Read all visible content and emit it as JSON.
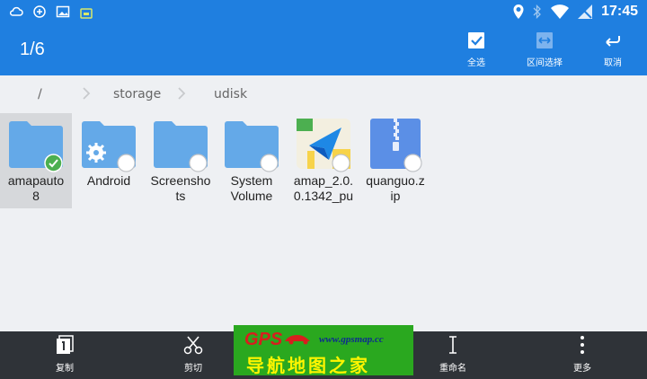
{
  "status_bar": {
    "time": "17:45",
    "left_icons": [
      "cloud-icon",
      "sync-icon",
      "image-icon",
      "android-icon"
    ],
    "right_icons": [
      "location-icon",
      "bluetooth-icon",
      "wifi-icon",
      "no-signal-icon"
    ]
  },
  "app_bar": {
    "selection_count": "1/6",
    "actions": [
      {
        "label": "全选",
        "icon": "select-all-icon"
      },
      {
        "label": "区间选择",
        "icon": "range-select-icon"
      },
      {
        "label": "取消",
        "icon": "cancel-icon"
      }
    ]
  },
  "breadcrumb": {
    "items": [
      "/",
      "storage",
      "udisk"
    ]
  },
  "files": [
    {
      "name": "amapauto8",
      "name_lines": [
        "amapauto",
        "8"
      ],
      "type": "folder",
      "selected": true
    },
    {
      "name": "Android",
      "name_lines": [
        "Android"
      ],
      "type": "folder-settings",
      "selected": false
    },
    {
      "name": "Screenshots",
      "name_lines": [
        "Screensho",
        "ts"
      ],
      "type": "folder",
      "selected": false
    },
    {
      "name": "System Volume",
      "name_lines": [
        "System",
        "Volume"
      ],
      "type": "folder",
      "selected": false
    },
    {
      "name": "amap_2.0.0.1342_pu",
      "name_lines": [
        "amap_2.0.",
        "0.1342_pu"
      ],
      "type": "apk",
      "selected": false
    },
    {
      "name": "quanguo.zip",
      "name_lines": [
        "quanguo.z",
        "ip"
      ],
      "type": "zip",
      "selected": false
    }
  ],
  "bottom_bar": {
    "items": [
      {
        "label": "复制",
        "icon": "copy-icon"
      },
      {
        "label": "剪切",
        "icon": "cut-icon"
      },
      {
        "label": "重命名",
        "icon": "rename-icon"
      },
      {
        "label": "更多",
        "icon": "more-icon"
      }
    ]
  },
  "watermark": {
    "brand": "GPS",
    "url": "www.gpsmap.cc",
    "text": "导航地图之家"
  },
  "colors": {
    "primary": "#1f7fe0",
    "folder": "#64a9e8",
    "selected_check": "#4caf50",
    "bottom_bar": "#2f3338",
    "watermark_bg": "#2aa81f"
  }
}
